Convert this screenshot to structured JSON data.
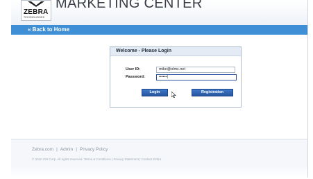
{
  "header": {
    "logo_text": "ZEBRA",
    "logo_subtext": "TECHNOLOGIES",
    "app_title": "MARKETING CENTER"
  },
  "nav": {
    "back_label": "« Back to Home"
  },
  "login": {
    "title": "Welcome - Please Login",
    "user_id_label": "User ID:",
    "user_id_value": "mike@olmc.net",
    "password_label": "Password:",
    "password_value": "••••••|",
    "login_button": "Login",
    "registration_button": "Registration"
  },
  "footer": {
    "links": [
      "Zebra.com",
      "Admin",
      "Privacy Policy"
    ],
    "separator": "|",
    "copyright": "© 2010 ZIH Corp. All rights reserved. Terms & Conditions | Privacy Statement | Contact Zebra"
  },
  "colors": {
    "accent": "#3f8fd6",
    "button": "#26559f"
  }
}
